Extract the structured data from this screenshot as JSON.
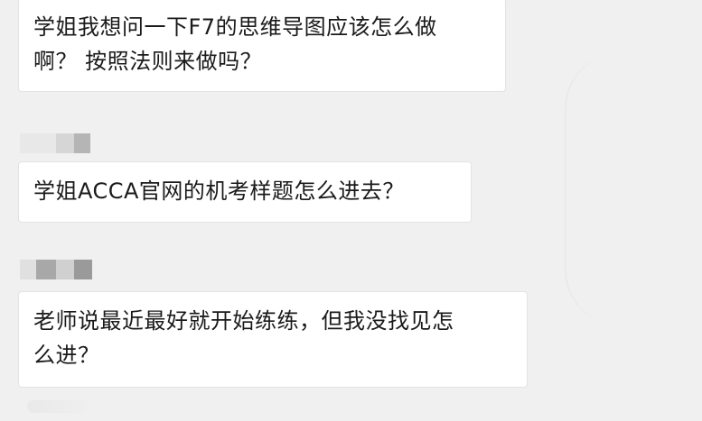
{
  "messages": [
    {
      "lines": [
        "学姐我想问一下F7的思维导图应该怎么做",
        "啊？  按照法则来做吗？"
      ]
    },
    {
      "lines": [
        "学姐ACCA官网的机考样题怎么进去？"
      ]
    },
    {
      "lines": [
        "老师说最近最好就开始练练，但我没找见怎",
        "么进？"
      ]
    }
  ],
  "colors": {
    "background": "#f0f0f0",
    "bubble": "#ffffff",
    "text": "#1a1a1a",
    "avatar_blur_light": "#e2e2e2",
    "avatar_blur_dark": "#9a9a9a"
  }
}
